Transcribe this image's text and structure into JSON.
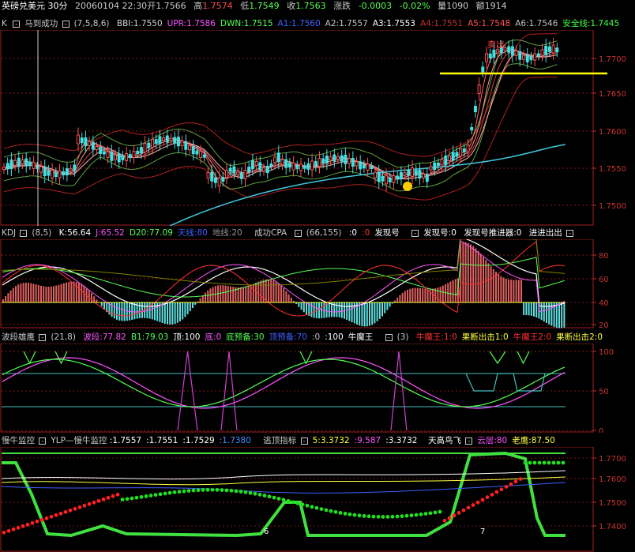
{
  "info_bar": {
    "symbol": "英磅兑美元 30分",
    "datetime": "20060104 22:30",
    "open_label": "开",
    "open": "1.7566",
    "high_label": "高",
    "high": "1.7574",
    "low_label": "低",
    "low": "1.7549",
    "close_label": "收",
    "close": "1.7563",
    "change_label": "涨跌",
    "change": "-0.0003",
    "change_pct": "-0.02%",
    "volume": "量1090",
    "amount": "额1914"
  },
  "main_panel": {
    "toggle": "K",
    "indicator": "马到成功",
    "params": "(7,5,8,6)",
    "values": [
      {
        "text": "BBI:1.7550",
        "color": "#d0d0d0"
      },
      {
        "text": "UPR:1.7586",
        "color": "#ff55ff"
      },
      {
        "text": "DWN:1.7515",
        "color": "#55ff55"
      },
      {
        "text": "A1:1.7560",
        "color": "#4060ff"
      },
      {
        "text": "A2:1.7557",
        "color": "#c0c0c0"
      },
      {
        "text": "A3:1.7553",
        "color": "#ffffff"
      },
      {
        "text": "A4:1.7551",
        "color": "#c03030"
      },
      {
        "text": "A5:1.7548",
        "color": "#ff5050"
      },
      {
        "text": "A6:1.7546",
        "color": "#c0c0c0"
      },
      {
        "text": "安全线:1.7445",
        "color": "#40ff40"
      }
    ],
    "annotation_sell": "卖出",
    "axis_ticks": [
      "1.7700",
      "1.7650",
      "1.7600",
      "1.7550",
      "1.7500"
    ]
  },
  "kdj_panel": {
    "name": "KDJ",
    "params": "(8,5)",
    "values": [
      {
        "text": "K:56.64",
        "color": "#ffffff"
      },
      {
        "text": "J:65.52",
        "color": "#ff55ff"
      },
      {
        "text": "D20:77.09",
        "color": "#55ff55"
      },
      {
        "text": "天线:80",
        "color": "#4060ff"
      },
      {
        "text": "地线:20",
        "color": "#909090"
      }
    ],
    "sub_name": "成功CPA",
    "sub_params": "(66,155)",
    "sub_values": [
      {
        "text": ":0",
        "color": "#ffffff"
      },
      {
        "text": ":0",
        "color": "#ff3030"
      },
      {
        "text": "发现号",
        "color": "#ffffff"
      }
    ],
    "extra": [
      "发现号:0",
      "发现号推进器:0",
      "进进出出"
    ],
    "axis_ticks": [
      "80",
      "60",
      "40",
      "20"
    ]
  },
  "wave_panel": {
    "name": "波段雄鹰",
    "params": "(21,8)",
    "values": [
      {
        "text": "波段:77.82",
        "color": "#ff55ff"
      },
      {
        "text": "B1:79.03",
        "color": "#55ff55"
      },
      {
        "text": "顶:100",
        "color": "#ffffff"
      },
      {
        "text": "底:0",
        "color": "#ff55ff"
      },
      {
        "text": "底预备:30",
        "color": "#55ff55"
      },
      {
        "text": "顶预备:70",
        "color": "#4060ff"
      },
      {
        "text": ":0",
        "color": "#c0c0c0"
      },
      {
        "text": ":100",
        "color": "#ffffff"
      },
      {
        "text": "牛魔王",
        "color": "#ffffff"
      }
    ],
    "sub_params": "(3)",
    "sub_values": [
      {
        "text": "牛魔王:1:0",
        "color": "#ff3030"
      },
      {
        "text": "果断出击1:0",
        "color": "#ffff40"
      },
      {
        "text": "牛魔王2:0",
        "color": "#ff3030"
      },
      {
        "text": "果断出击2:0",
        "color": "#ffff40"
      }
    ],
    "axis_ticks": [
      "100",
      "50",
      "0"
    ]
  },
  "bull_panel": {
    "name": "慢牛监控",
    "sub_name": "YLP—慢牛监控",
    "values": [
      {
        "text": ":1.7557",
        "color": "#ffffff"
      },
      {
        "text": ":1.7551",
        "color": "#ffffff"
      },
      {
        "text": ":1.7529",
        "color": "#ffffff"
      },
      {
        "text": ":1.7380",
        "color": "#4090ff"
      }
    ],
    "sub2_name": "逃顶指标",
    "sub2_values": [
      {
        "text": "5:3.3732",
        "color": "#ffff40"
      },
      {
        "text": ":9.587",
        "color": "#ff55ff"
      },
      {
        "text": ":3.3732",
        "color": "#ffffff"
      }
    ],
    "right_title": "天高鸟飞",
    "right_values": [
      {
        "text": "云层:80",
        "color": "#ff55ff"
      },
      {
        "text": "老鹰:87.50",
        "color": "#ffff40"
      }
    ],
    "markers": [
      "6",
      "7"
    ],
    "axis_ticks": [
      "1.7700",
      "1.7600",
      "1.7500",
      "1.7400"
    ]
  }
}
